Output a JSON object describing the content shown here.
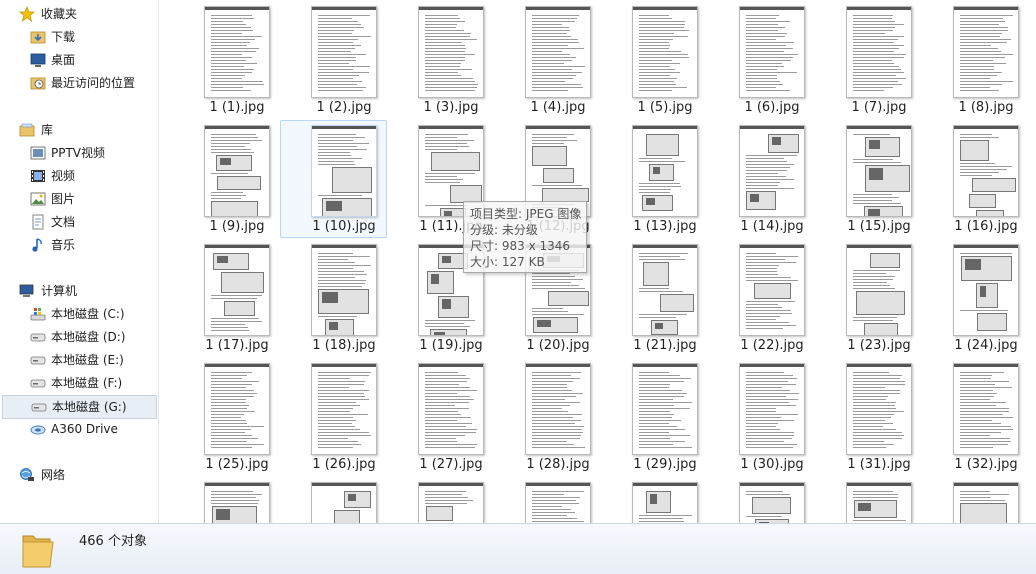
{
  "sidebar": {
    "favorites": {
      "label": "收藏夹",
      "icon": "star-icon"
    },
    "favorites_items": [
      {
        "label": "下载",
        "icon": "downloads-folder-icon"
      },
      {
        "label": "桌面",
        "icon": "desktop-icon"
      },
      {
        "label": "最近访问的位置",
        "icon": "recent-places-icon"
      }
    ],
    "libraries": {
      "label": "库",
      "icon": "library-icon"
    },
    "library_items": [
      {
        "label": "PPTV视频",
        "icon": "video-library-icon"
      },
      {
        "label": "视频",
        "icon": "video-library-icon"
      },
      {
        "label": "图片",
        "icon": "pictures-library-icon"
      },
      {
        "label": "文档",
        "icon": "documents-library-icon"
      },
      {
        "label": "音乐",
        "icon": "music-library-icon"
      }
    ],
    "computer": {
      "label": "计算机",
      "icon": "computer-icon"
    },
    "computer_items": [
      {
        "label": "本地磁盘 (C:)",
        "icon": "system-drive-icon"
      },
      {
        "label": "本地磁盘 (D:)",
        "icon": "hard-drive-icon"
      },
      {
        "label": "本地磁盘 (E:)",
        "icon": "hard-drive-icon"
      },
      {
        "label": "本地磁盘 (F:)",
        "icon": "hard-drive-icon"
      },
      {
        "label": "本地磁盘 (G:)",
        "icon": "hard-drive-icon",
        "selected": true
      },
      {
        "label": "A360 Drive",
        "icon": "cloud-drive-icon"
      }
    ],
    "network": {
      "label": "网络",
      "icon": "network-icon"
    }
  },
  "files": [
    "1 (1).jpg",
    "1 (2).jpg",
    "1 (3).jpg",
    "1 (4).jpg",
    "1 (5).jpg",
    "1 (6).jpg",
    "1 (7).jpg",
    "1 (8).jpg",
    "1 (9).jpg",
    "1 (10).jpg",
    "1 (11).jpg",
    "1 (12).jpg",
    "1 (13).jpg",
    "1 (14).jpg",
    "1 (15).jpg",
    "1 (16).jpg",
    "1 (17).jpg",
    "1 (18).jpg",
    "1 (19).jpg",
    "1 (20).jpg",
    "1 (21).jpg",
    "1 (22).jpg",
    "1 (23).jpg",
    "1 (24).jpg",
    "1 (25).jpg",
    "1 (26).jpg",
    "1 (27).jpg",
    "1 (28).jpg",
    "1 (29).jpg",
    "1 (30).jpg",
    "1 (31).jpg",
    "1 (32).jpg",
    "",
    "",
    "",
    "",
    "",
    "",
    "",
    ""
  ],
  "tooltip": {
    "type": "项目类型: JPEG 图像",
    "rating": "分级: 未分级",
    "dimensions": "尺寸: 983 x 1346",
    "size": "大小: 127 KB"
  },
  "status": {
    "count": "466 个对象",
    "icon": "folder-icon"
  }
}
